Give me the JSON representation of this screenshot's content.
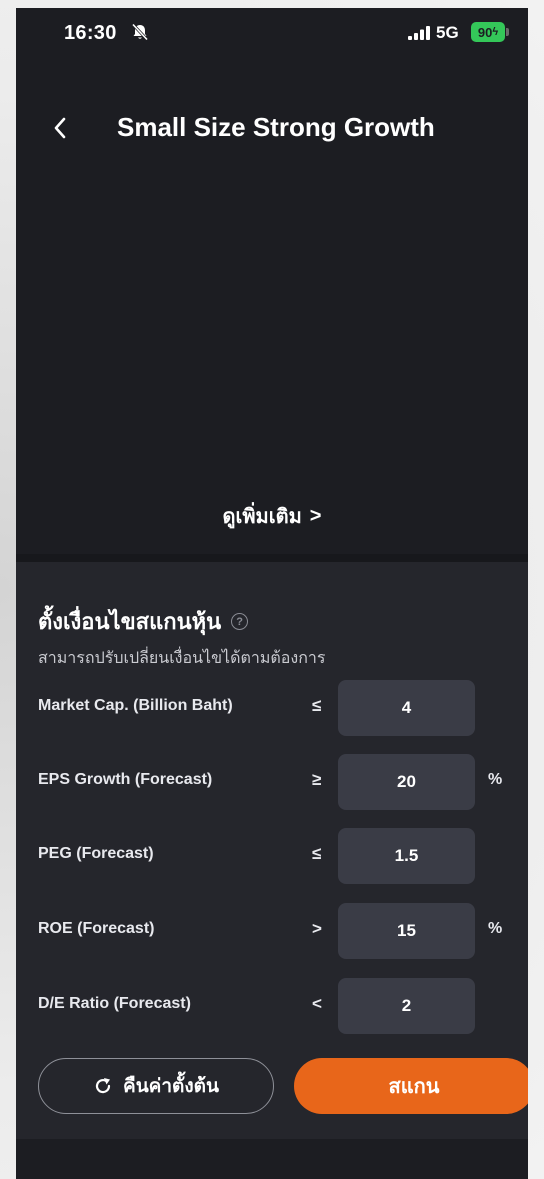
{
  "status": {
    "time": "16:30",
    "network": "5G",
    "battery": "90"
  },
  "header": {
    "title": "Small Size Strong Growth"
  },
  "see_more": {
    "label": "ดูเพิ่มเติม",
    "chevron": ">"
  },
  "screener": {
    "title": "ตั้งเงื่อนไขสแกนหุ้น",
    "subtitle": "สามารถปรับเปลี่ยนเงื่อนไขได้ตามต้องการ",
    "rows": [
      {
        "label": "Market Cap. (Billion Baht)",
        "op": "≤",
        "value": "4",
        "unit": ""
      },
      {
        "label": "EPS Growth (Forecast)",
        "op": "≥",
        "value": "20",
        "unit": "%"
      },
      {
        "label": "PEG (Forecast)",
        "op": "≤",
        "value": "1.5",
        "unit": ""
      },
      {
        "label": "ROE (Forecast)",
        "op": ">",
        "value": "15",
        "unit": "%"
      },
      {
        "label": "D/E Ratio (Forecast)",
        "op": "<",
        "value": "2",
        "unit": ""
      }
    ]
  },
  "actions": {
    "reset_label": "คืนค่าตั้งต้น",
    "scan_label": "สแกน"
  },
  "colors": {
    "background": "#1c1d22",
    "panel": "#25262c",
    "input": "#3a3c46",
    "accent": "#e8661a",
    "battery": "#34c759"
  }
}
